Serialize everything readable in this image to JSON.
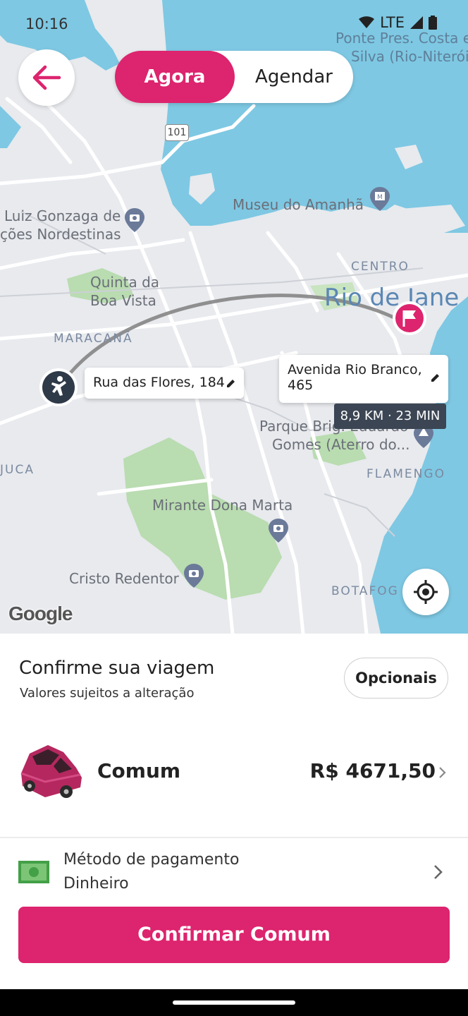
{
  "status": {
    "time": "10:16",
    "network": "LTE"
  },
  "header": {
    "mode_active": "Agora",
    "mode_inactive": "Agendar"
  },
  "map": {
    "labels": {
      "ponte": "Ponte Pres. Costa e",
      "ponte2": "Silva (Rio-Niterói",
      "road101": "101",
      "museu": "Museu do Amanhã",
      "luiz1": "Luiz Gonzaga de",
      "luiz2": "ções Nordestinas",
      "quinta1": "Quinta da",
      "quinta2": "Boa Vista",
      "centro": "CENTRO",
      "rio": "Rio de Jane",
      "maracana": "MARACANÃ",
      "parque1": "Parque Brig. Eduardo",
      "parque2": "Gomes (Aterro do...",
      "juca": "JUCA",
      "flamengo": "FLAMENGO",
      "mirante": "Mirante Dona Marta",
      "cristo": "Cristo Redentor",
      "botafogo": "BOTAFOG",
      "google": "Google"
    },
    "origin_card": "Rua das Flores, 184",
    "destination_card_line1": "Avenida Rio Branco,",
    "destination_card_line2": "465",
    "trip_summary": "8,9 KM · 23 MIN"
  },
  "sheet": {
    "title": "Confirme sua viagem",
    "subtitle": "Valores sujeitos a alteração",
    "options_button": "Opcionais",
    "ride": {
      "name": "Comum",
      "price": "R$ 4671,50"
    },
    "payment": {
      "label": "Método de pagamento",
      "value": "Dinheiro"
    },
    "confirm_button": "Confirmar Comum"
  },
  "colors": {
    "brand": "#dd246e",
    "water": "#7ec8e3",
    "land": "#e8eaee",
    "park": "#b9dcb0"
  }
}
